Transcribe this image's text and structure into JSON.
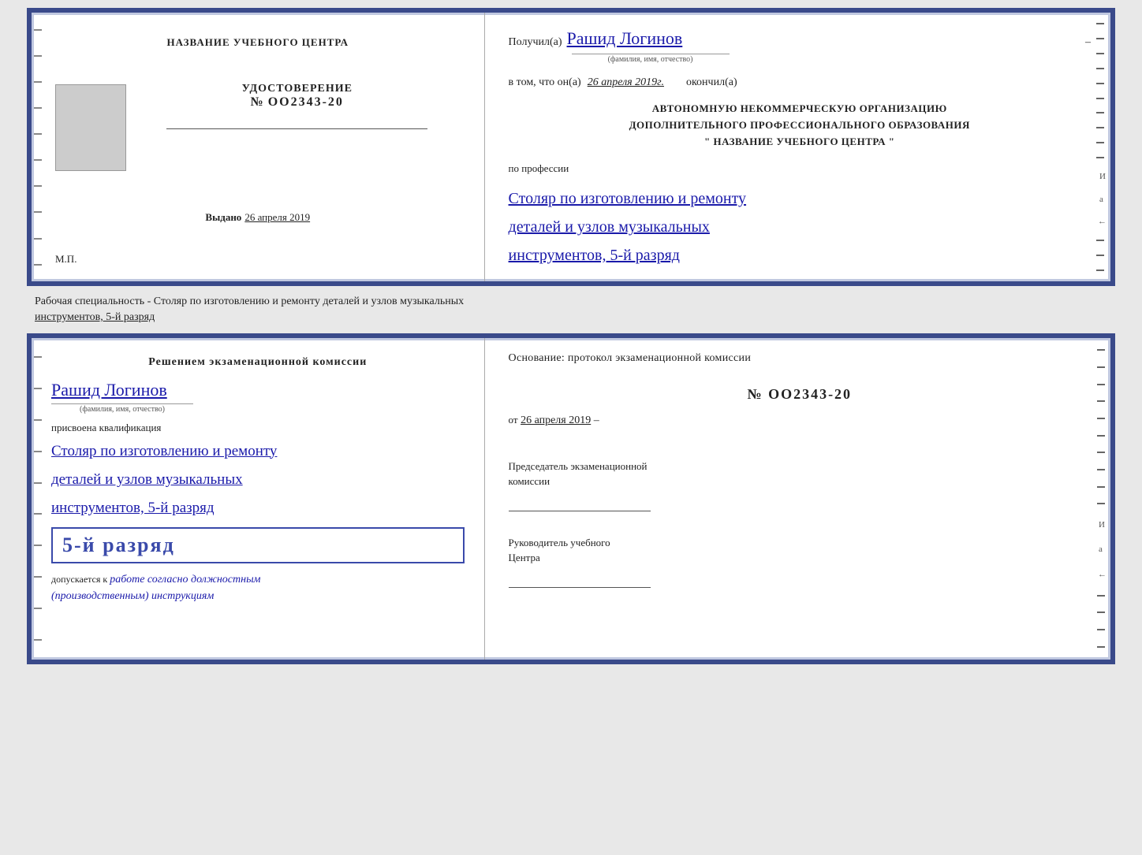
{
  "top_doc": {
    "left": {
      "center_title": "НАЗВАНИЕ УЧЕБНОГО ЦЕНТРА",
      "cert_label": "УДОСТОВЕРЕНИЕ",
      "cert_number_prefix": "№",
      "cert_number": "OO2343-20",
      "issue_label": "Выдано",
      "issue_date": "26 апреля 2019",
      "mp_label": "М.П."
    },
    "right": {
      "recipient_label": "Получил(а)",
      "recipient_name": "Рашид Логинов",
      "fio_sub": "(фамилия, имя, отчество)",
      "completed_label": "в том, что он(а)",
      "completed_date": "26 апреля 2019г.",
      "completed_end": "окончил(а)",
      "org_line1": "АВТОНОМНУЮ НЕКОММЕРЧЕСКУЮ ОРГАНИЗАЦИЮ",
      "org_line2": "ДОПОЛНИТЕЛЬНОГО ПРОФЕССИОНАЛЬНОГО ОБРАЗОВАНИЯ",
      "org_line3": "\"   НАЗВАНИЕ УЧЕБНОГО ЦЕНТРА   \"",
      "profession_label": "по профессии",
      "profession_hw1": "Столяр по изготовлению и ремонту",
      "profession_hw2": "деталей и узлов музыкальных",
      "profession_hw3": "инструментов, 5-й разряд"
    }
  },
  "specialty_text": {
    "line1": "Рабочая специальность - Столяр по изготовлению и ремонту деталей и узлов музыкальных",
    "line2": "инструментов, 5-й разряд"
  },
  "bottom_doc": {
    "left": {
      "decision_title1": "Решением экзаменационной комиссии",
      "person_name": "Рашид Логинов",
      "fio_sub": "(фамилия, имя, отчество)",
      "qualification_label": "присвоена квалификация",
      "qual_hw1": "Столяр по изготовлению и ремонту",
      "qual_hw2": "деталей и узлов музыкальных",
      "qual_hw3": "инструментов, 5-й разряд",
      "rank_text": "5-й разряд",
      "allowed_label": "допускается к",
      "allowed_hw": "работе согласно должностным",
      "allowed_hw2": "(производственным) инструкциям"
    },
    "right": {
      "basis_label": "Основание: протокол экзаменационной комиссии",
      "proto_prefix": "№",
      "proto_number": "OO2343-20",
      "proto_date_prefix": "от",
      "proto_date": "26 апреля 2019",
      "chair_label1": "Председатель экзаменационной",
      "chair_label2": "комиссии",
      "head_label1": "Руководитель учебного",
      "head_label2": "Центра"
    }
  },
  "deco": {
    "И": "И",
    "а": "а",
    "arrow": "←"
  }
}
